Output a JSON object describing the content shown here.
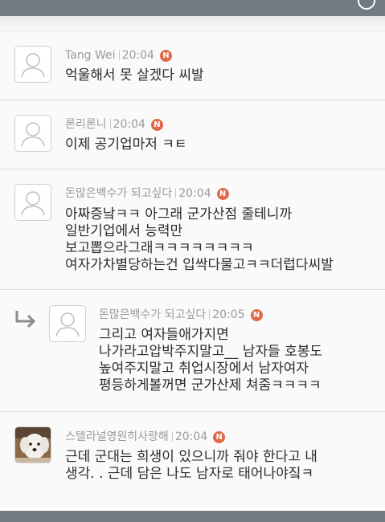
{
  "header": {
    "close_icon": "close-icon"
  },
  "badge_label": "N",
  "badge_color": "#e0684a",
  "comments": [
    {
      "author": "Tang Wei",
      "time": "20:04",
      "lines": [
        "억울해서 못 살겠다 씨발"
      ]
    },
    {
      "author": "론리론니",
      "time": "20:04",
      "lines": [
        "이제 공기업마저 ㅋㅌ"
      ]
    },
    {
      "author": "돈많은백수가 되고싶다",
      "time": "20:04",
      "lines": [
        "아짜증낰ㅋㅋ 아그래 군가산점 줄테니까",
        "일반기업에서 능력만",
        "보고뽑으라그래ㅋㅋㅋㅋㅋㅋㅋㅋ",
        "여자가차별당하는건 입싹다물고ㅋㅋ더럽다씨발"
      ]
    },
    {
      "author": "돈많은백수가 되고싶다",
      "time": "20:05",
      "is_reply": true,
      "lines": [
        "그리고 여자들애가지면",
        "나가라고압박주지말고__ 남자들 호봉도",
        "높여주지말고 취업시장에서 남자여자",
        "평등하게볼꺼면 군가산제 쳐줌ㅋㅋㅋㅋ"
      ]
    },
    {
      "author": "스텔라널영원히사랑해",
      "time": "20:04",
      "photo_avatar": true,
      "lines": [
        "근데 군대는 희생이 있으니까 줘야 한다고 내",
        "생각. . 근데 담은 나도 남자로 태어나야짘ㅋ"
      ]
    }
  ]
}
